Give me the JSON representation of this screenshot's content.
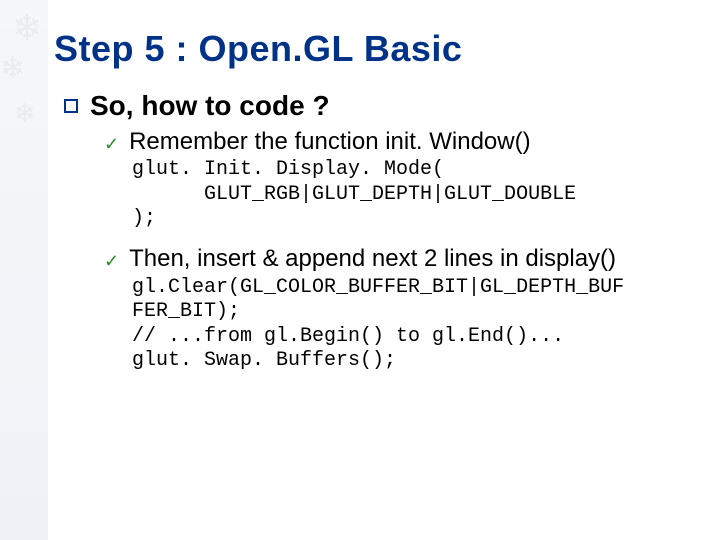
{
  "sidebar": {
    "snowflakes": [
      "❄",
      "❄",
      "❄"
    ]
  },
  "title": "Step 5 : Open.GL Basic",
  "question": "So, how to code ?",
  "items": [
    {
      "text": "Remember the function init. Window()",
      "code": "glut. Init. Display. Mode(\n      GLUT_RGB|GLUT_DEPTH|GLUT_DOUBLE\n);"
    },
    {
      "text": "Then, insert & append next 2 lines in display()",
      "code": "gl.Clear(GL_COLOR_BUFFER_BIT|GL_DEPTH_BUF\nFER_BIT);\n// ...from gl.Begin() to gl.End()...\nglut. Swap. Buffers();"
    }
  ]
}
